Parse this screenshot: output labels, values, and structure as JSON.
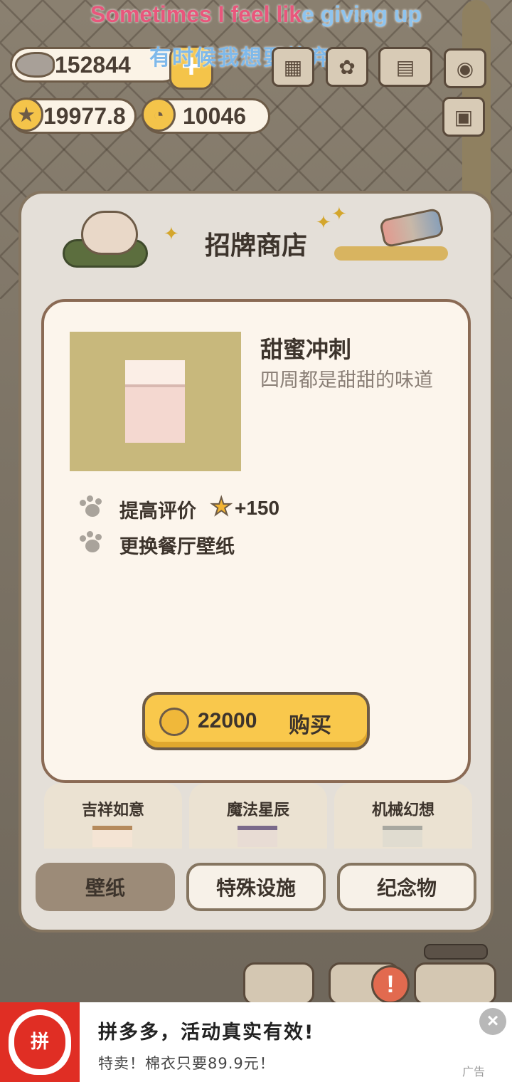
{
  "subtitles": {
    "english_part1": "Sometimes I feel lik",
    "english_part2": "e giving up",
    "chinese": "有时候我想要放弃"
  },
  "currencies": {
    "fish": "152844",
    "stars": "19977.8",
    "bells": "10046",
    "add_label": "+"
  },
  "shop": {
    "title": "招牌商店",
    "item": {
      "name": "甜蜜冲刺",
      "description": "四周都是甜甜的味道",
      "features": [
        {
          "text": "提高评价",
          "bonus": "+150"
        },
        {
          "text": "更换餐厅壁纸"
        }
      ],
      "price": "22000",
      "buy_label": "购买"
    },
    "wallpapers": [
      "吉祥如意",
      "魔法星辰",
      "机械幻想"
    ],
    "tabs": [
      "壁纸",
      "特殊设施",
      "纪念物"
    ],
    "active_tab": "壁纸"
  },
  "notification_badge": "!",
  "ad": {
    "title": "拼多多，活动真实有效!",
    "subtitle": "特卖！棉衣只要89.9元！",
    "tag": "广告",
    "logo_text": "拼",
    "close_icon": "×"
  },
  "colors": {
    "accent_yellow": "#f9c84c",
    "panel_bg": "#e4dfd8",
    "card_bg": "#fcf5ec",
    "ad_red": "#e02e24"
  }
}
